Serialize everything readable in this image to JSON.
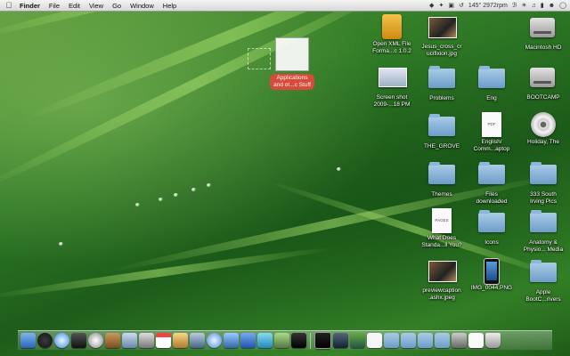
{
  "menubar": {
    "app_name": "Finder",
    "menus": [
      "File",
      "Edit",
      "View",
      "Go",
      "Window",
      "Help"
    ],
    "status_text": "145° 2972rpm"
  },
  "dragged_item": {
    "label": "Applications\nand ot...c Stuff"
  },
  "desktop_icons": [
    {
      "label": "Open XML File\nForma...c 1.0.2",
      "icon": "outlook-installer-icon"
    },
    {
      "label": "Jesus_cross_cr\nucifixion.jpg",
      "icon": "image-thumbnail-icon"
    },
    {
      "label": "Macintosh HD",
      "icon": "hard-drive-icon"
    },
    {
      "label": "Screen shot\n2009-...18 PM",
      "icon": "screenshot-thumbnail-icon"
    },
    {
      "label": "Problems",
      "icon": "folder-icon"
    },
    {
      "label": "Eng",
      "icon": "folder-icon"
    },
    {
      "label": "BOOTCAMP",
      "icon": "hard-drive-icon"
    },
    {
      "label": "THE_GROVE",
      "icon": "folder-icon"
    },
    {
      "label": "English/\nComm...aptop",
      "icon": "pdf-document-icon"
    },
    {
      "label": "Holiday, The",
      "icon": "dvd-icon"
    },
    {
      "label": "Themes",
      "icon": "folder-icon"
    },
    {
      "label": "Files\ndownloaded",
      "icon": "folder-icon"
    },
    {
      "label": "333 South\nIrving Pics",
      "icon": "folder-icon"
    },
    {
      "label": "What Does\nStanda...ll You?",
      "icon": "pages-document-icon"
    },
    {
      "label": "Icons",
      "icon": "folder-icon"
    },
    {
      "label": "Anatomy &\nPhysio... Media",
      "icon": "folder-icon"
    },
    {
      "label": "previewcaption\n.ashx.jpeg",
      "icon": "image-thumbnail-icon"
    },
    {
      "label": "IMG_0044.PNG",
      "icon": "iphone-image-icon"
    },
    {
      "label": "Apple\nBootC...rivers",
      "icon": "folder-icon"
    }
  ],
  "doc_badges": {
    "pdf": "PDF",
    "pages": "PAGES"
  },
  "dock_items": [
    "finder-icon",
    "dashboard-icon",
    "safari-icon",
    "quicktime-icon",
    "clock-icon",
    "address-book-icon",
    "preview-icon",
    "utility-icon",
    "calendar-icon",
    "photos-icon",
    "mail-icon",
    "itunes-icon",
    "music-icon",
    "web-icon",
    "twitter-icon",
    "bird-icon",
    "activity-icon",
    "terminal-icon",
    "spaces-icon",
    "photo-icon",
    "document-icon",
    "folder-stack-icon",
    "downloads-stack-icon",
    "documents-stack-icon",
    "applications-stack-icon",
    "screens-icon",
    "page-icon",
    "trash-icon"
  ]
}
